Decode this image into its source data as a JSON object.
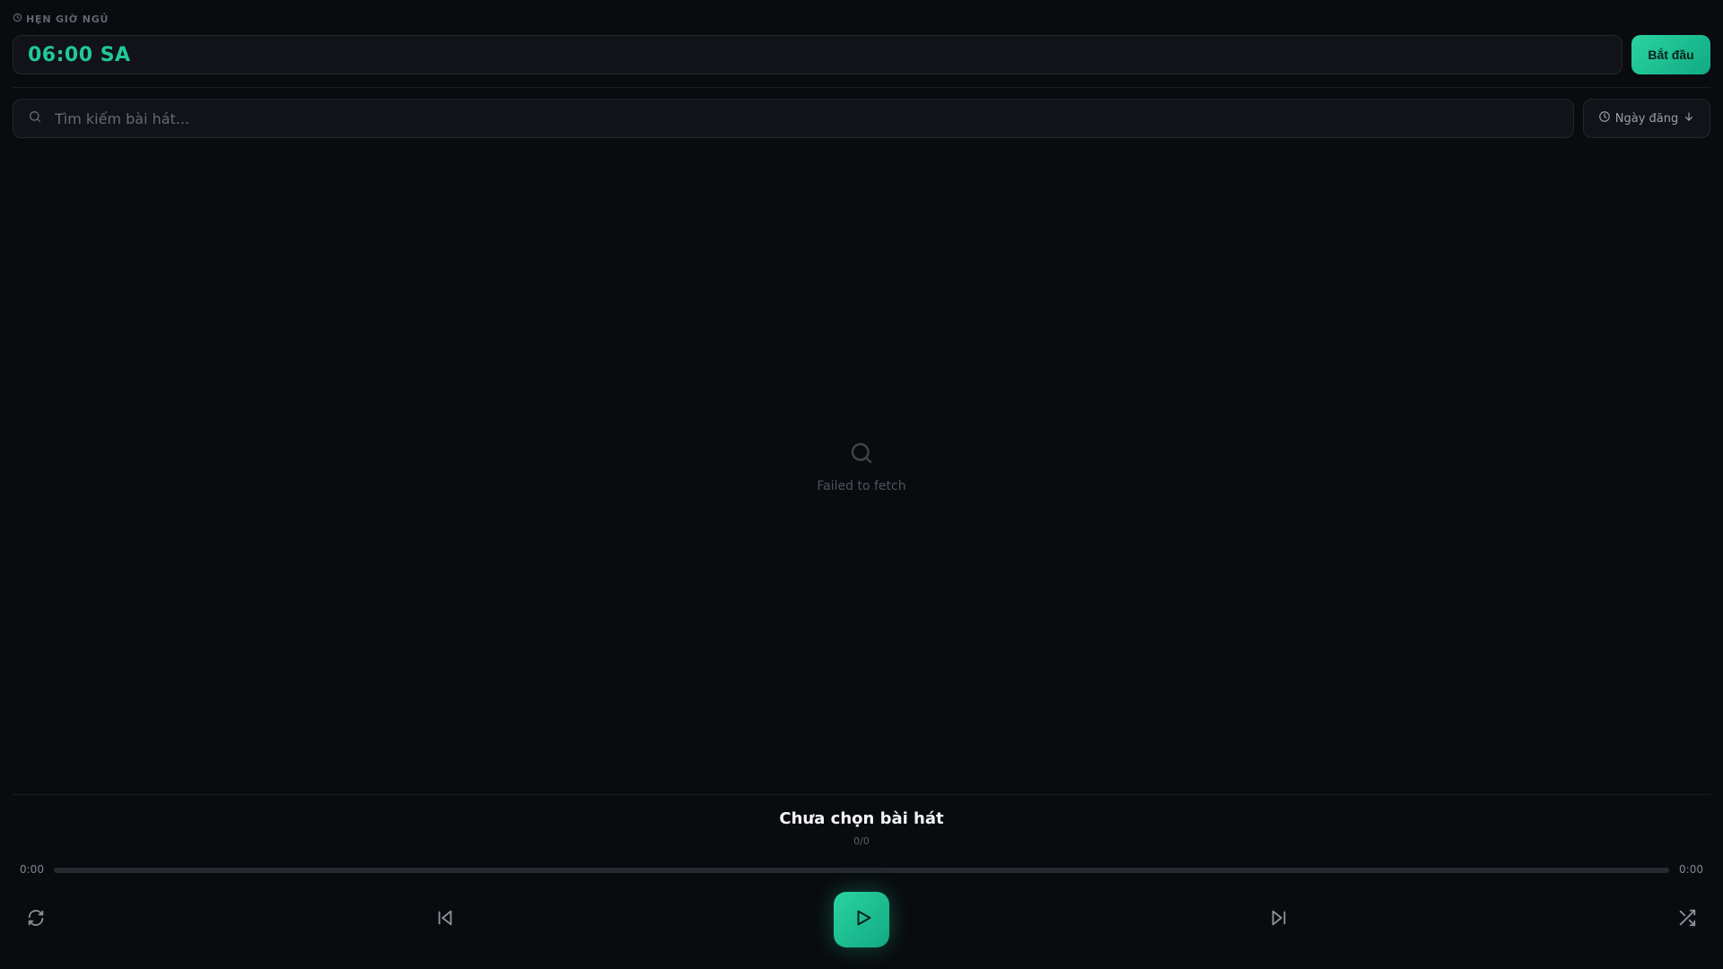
{
  "sleep_timer": {
    "label": "HẸN GIỜ NGỦ",
    "time_value": "06:00 SA",
    "start_label": "Bắt đầu"
  },
  "search": {
    "placeholder": "Tìm kiếm bài hát...",
    "value": ""
  },
  "sort": {
    "label": "Ngày đăng",
    "direction": "descending"
  },
  "empty_state": {
    "message": "Failed to fetch"
  },
  "player": {
    "title": "Chưa chọn bài hát",
    "track_count": "0/0",
    "time_current": "0:00",
    "time_total": "0:00",
    "progress_fraction": 0
  },
  "colors": {
    "background": "#090b0f",
    "accent": "#22c997",
    "surface": "#111318",
    "border": "#23262d"
  },
  "icons": {
    "timer": "clock-icon",
    "search": "search-icon",
    "sort": "clock-icon",
    "sort_direction": "arrow-down-icon",
    "empty": "search-icon",
    "repeat": "repeat-icon",
    "previous": "skip-back-icon",
    "play": "play-icon",
    "next": "skip-forward-icon",
    "shuffle": "shuffle-icon"
  }
}
